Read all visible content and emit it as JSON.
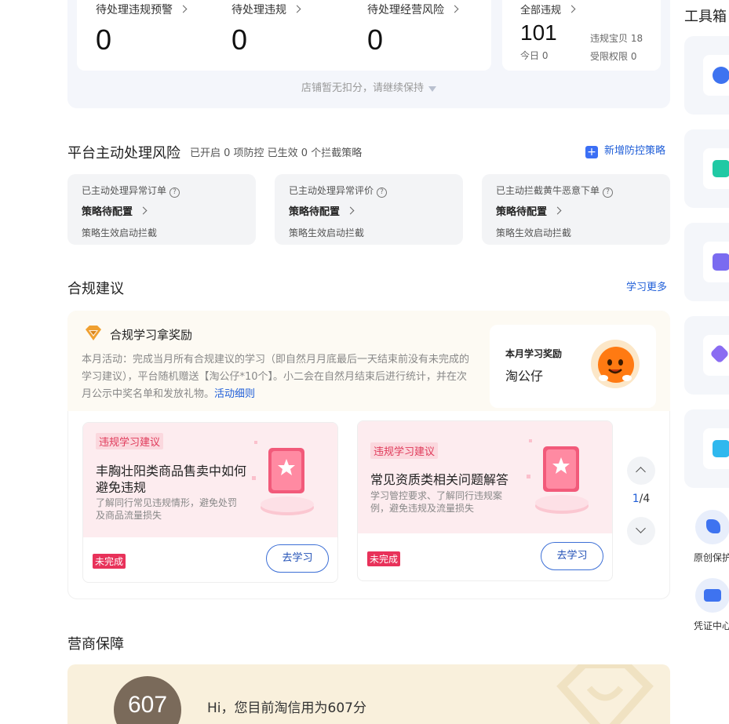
{
  "top_stats": {
    "items": [
      {
        "label": "待处理违规预警",
        "value": "0"
      },
      {
        "label": "待处理违规",
        "value": "0"
      },
      {
        "label": "待处理经营风险",
        "value": "0"
      }
    ],
    "all": {
      "label": "全部违规",
      "value": "101",
      "today": "今日 0",
      "baby": "违规宝贝 18",
      "limit": "受限权限 0"
    },
    "hint": "店铺暂无扣分，请继续保持"
  },
  "platform_risk": {
    "title": "平台主动处理风险",
    "subtitle": "已开启 0 项防控 已生效 0 个拦截策略",
    "add_link": "新增防控策略",
    "cards": [
      {
        "label": "已主动处理异常订单",
        "status": "策略待配置",
        "note": "策略生效启动拦截"
      },
      {
        "label": "已主动处理异常评价",
        "status": "策略待配置",
        "note": "策略生效启动拦截"
      },
      {
        "label": "已主动拦截黄牛恶意下单",
        "status": "策略待配置",
        "note": "策略生效启动拦截"
      }
    ]
  },
  "compliance": {
    "title": "合规建议",
    "more_link": "学习更多",
    "reward_title": "合规学习拿奖励",
    "desc": "本月活动：完成当月所有合规建议的学习（即自然月月底最后一天结束前没有未完成的学习建议），平台随机赠送【淘公仔*10个】。小二会在自然月结束后进行统计，并在次月公示中奖名单和发放礼物。",
    "desc_link": "活动细则",
    "reward_box": {
      "label": "本月学习奖励",
      "prize": "淘公仔"
    },
    "cards": [
      {
        "tag": "违规学习建议",
        "title": "丰胸壮阳类商品售卖中如何避免违规",
        "desc": "了解同行常见违规情形，避免处罚及商品流量损失",
        "status": "未完成",
        "button": "去学习"
      },
      {
        "tag": "违规学习建议",
        "title": "常见资质类相关问题解答",
        "desc": "学习管控要求、了解同行违规案例，避免违规及流量损失",
        "status": "未完成",
        "button": "去学习"
      }
    ],
    "pager": {
      "current": "1",
      "total": "/4"
    }
  },
  "guarantee": {
    "title": "营商保障",
    "score": "607",
    "text": "Hi，您目前淘信用为607分"
  },
  "toolbox": {
    "title": "工具箱",
    "side_items": [
      {
        "label": "原创保护"
      },
      {
        "label": "凭证中心"
      }
    ]
  },
  "colors": {
    "accent_blue": "#1f5ed8",
    "incomplete_red": "#e8325a",
    "tag_pink": "#fbd8de"
  }
}
